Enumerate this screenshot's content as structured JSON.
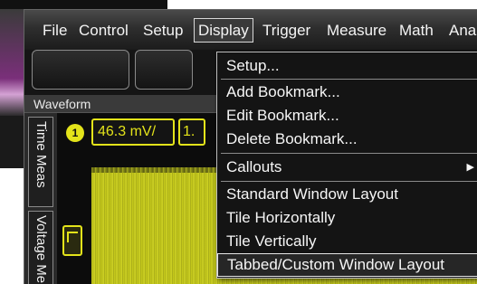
{
  "menubar": {
    "items": [
      "File",
      "Control",
      "Setup",
      "Display",
      "Trigger",
      "Measure",
      "Math",
      "Ana"
    ],
    "active": "Display"
  },
  "waveform_panel": {
    "title": "Waveform",
    "side_tabs": [
      "Time Meas",
      "Voltage Me"
    ],
    "channel_number": "1",
    "channel_scale": "46.3 mV/",
    "channel_scale_next": "1.",
    "waveform_color": "#d0d41f"
  },
  "display_menu": {
    "items": [
      {
        "label": "Setup..."
      },
      {
        "label": "Add Bookmark..."
      },
      {
        "label": "Edit Bookmark..."
      },
      {
        "label": "Delete Bookmark..."
      },
      {
        "label": "Callouts",
        "has_submenu": true
      },
      {
        "label": "Standard Window Layout"
      },
      {
        "label": "Tile Horizontally"
      },
      {
        "label": "Tile Vertically"
      },
      {
        "label": "Tabbed/Custom Window Layout",
        "highlighted": true
      }
    ],
    "submenu_arrow_icon": "triangle-right-icon"
  },
  "colors": {
    "accent_yellow": "#e3e31a",
    "menu_background": "#141414",
    "menu_text": "#f6f6f6"
  }
}
